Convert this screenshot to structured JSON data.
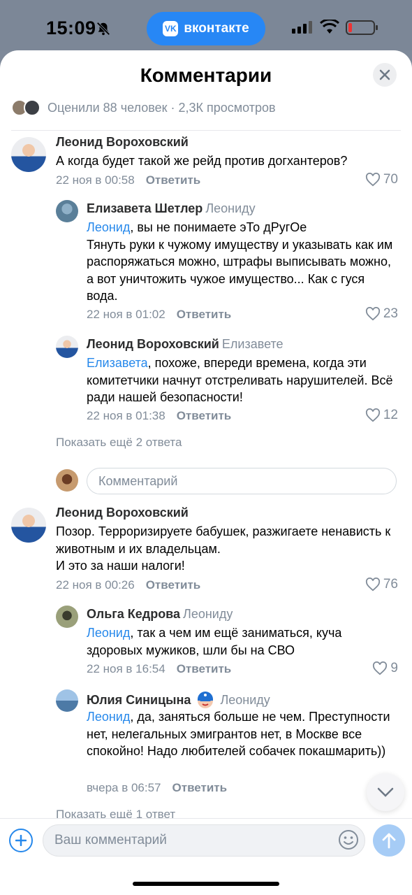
{
  "status_bar": {
    "time": "15:09",
    "app_pill": "вконтакте",
    "vk_logo": "VK",
    "icons": [
      "bell-slash-icon",
      "signal-icon",
      "wifi-icon",
      "battery-low-icon"
    ]
  },
  "sheet": {
    "title": "Комментарии",
    "meta": "Оценили 88 человек · 2,3К просмотров",
    "comments": [
      {
        "author": "Леонид Вороховский",
        "text": "А когда будет такой же рейд против догхантеров?",
        "time": "22 ноя в 00:58",
        "reply": "Ответить",
        "likes": "70",
        "replies": [
          {
            "author": "Елизавета Шетлер",
            "reply_to": "Леониду",
            "mention": "Леонид",
            "text": ", вы не понимаете эТо дРугОе\nТянуть руки к чужому имуществу и указывать как им распоряжаться можно, штрафы выписывать можно,  а вот уничтожить чужое имущество... Как с гуся вода.",
            "time": "22 ноя в 01:02",
            "reply": "Ответить",
            "likes": "23"
          },
          {
            "author": "Леонид Вороховский",
            "reply_to": "Елизавете",
            "mention": "Елизавета",
            "text": ", похоже, впереди времена, когда эти комитетчики начнут отстреливать нарушителей. Всё ради нашей безопасности!",
            "time": "22 ноя в 01:38",
            "reply": "Ответить",
            "likes": "12"
          }
        ],
        "show_more": "Показать ещё 2 ответа"
      },
      {
        "author": "Леонид Вороховский",
        "text": "Позор. Терроризируете бабушек, разжигаете ненависть к животным и их владельцам.\nИ это за наши налоги!",
        "time": "22 ноя в 00:26",
        "reply": "Ответить",
        "likes": "76",
        "replies": [
          {
            "author": "Ольга Кедрова",
            "reply_to": "Леониду",
            "mention": "Леонид",
            "text": ", так а чем им ещё заниматься, куча здоровых мужиков, шли бы на СВО",
            "time": "22 ноя в 16:54",
            "reply": "Ответить",
            "likes": "9"
          },
          {
            "author": "Юлия Синицына",
            "reply_to": "Леониду",
            "mention": "Леонид",
            "text": ", да, заняться больше не чем. Преступности нет, нелегальных эмигрантов нет, в Москве все спокойно! Надо любителей собачек покашмарить))",
            "time": "вчера в 06:57",
            "reply": "Ответить",
            "likes": ""
          }
        ],
        "show_more": "Показать ещё 1 ответ"
      }
    ],
    "inline_comment_placeholder": "Комментарий"
  },
  "compose": {
    "placeholder": "Ваш комментарий"
  },
  "colors": {
    "accent": "#2688eb",
    "secondary_text": "#818c99",
    "send_button": "#a6ccf6"
  }
}
